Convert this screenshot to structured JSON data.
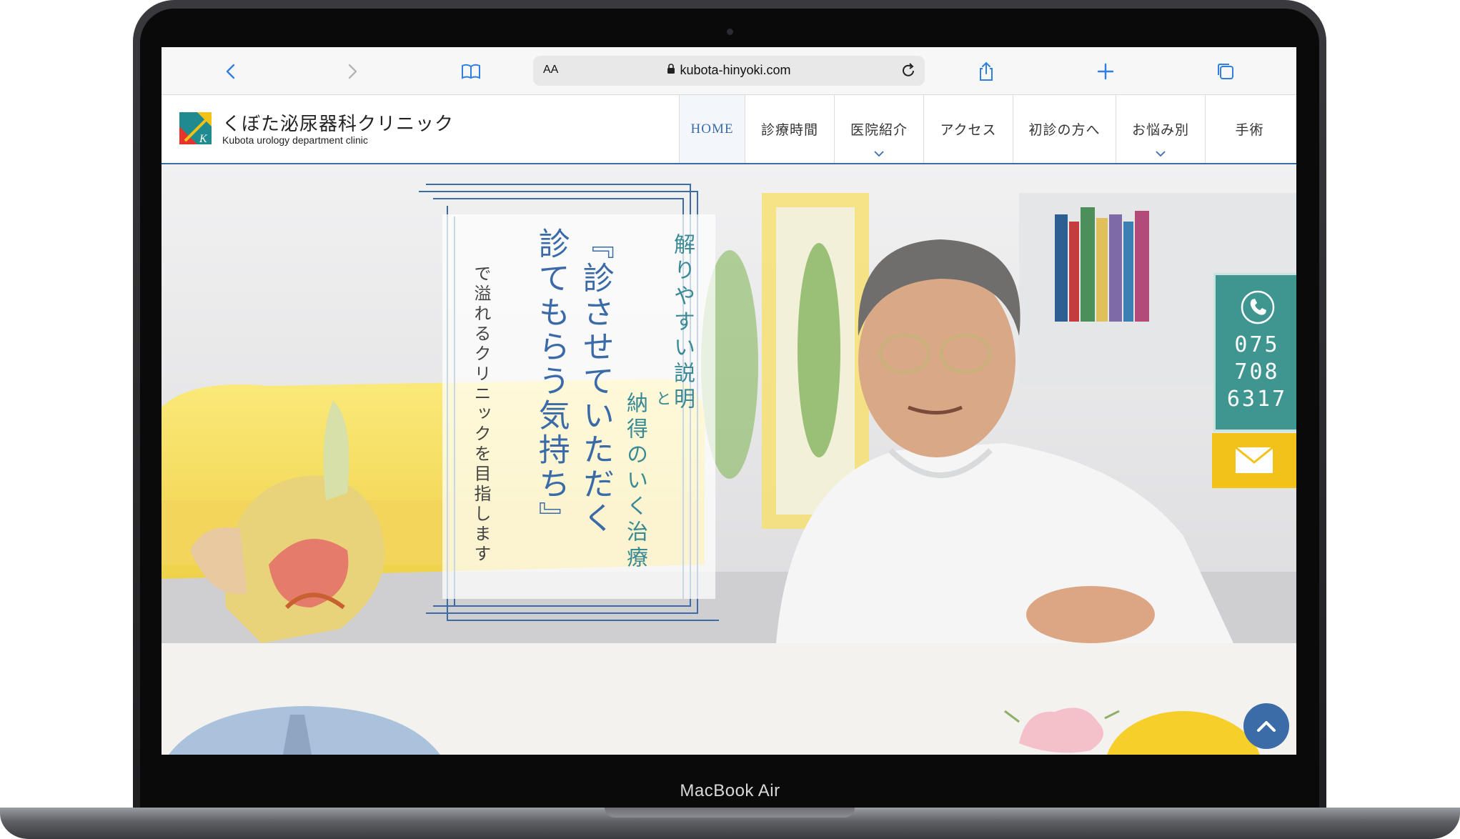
{
  "device": {
    "brand_label": "MacBook Air"
  },
  "browser": {
    "url_display": "kubota-hinyoki.com",
    "text_size_label": "AA",
    "icons": [
      "back-icon",
      "forward-icon",
      "bookmarks-icon",
      "lock-icon",
      "reload-icon",
      "share-icon",
      "new-tab-icon",
      "tabs-icon"
    ]
  },
  "site": {
    "logo_jp": "くぼた泌尿器科クリニック",
    "logo_en": "Kubota urology department clinic",
    "nav": [
      {
        "label": "HOME",
        "active": true
      },
      {
        "label": "診療時間"
      },
      {
        "label": "医院紹介",
        "dropdown": true
      },
      {
        "label": "アクセス"
      },
      {
        "label": "初診の方へ"
      },
      {
        "label": "お悩み別",
        "dropdown": true
      },
      {
        "label": "手術"
      }
    ]
  },
  "hero": {
    "line1": "解りやすい説明",
    "conj": "と",
    "line2": "納得のいく治療",
    "headline1": "『診させていただく",
    "headline2": "診てもらう気持ち』",
    "tagline": "で溢れるクリニックを目指します"
  },
  "contact": {
    "phone_lines": [
      "075",
      "708",
      "6317"
    ],
    "phone_icon": "phone-icon",
    "mail_icon": "mail-icon"
  },
  "colors": {
    "nav_accent": "#3c6ca8",
    "teal": "#3f9690",
    "yellow": "#f3c21a"
  }
}
